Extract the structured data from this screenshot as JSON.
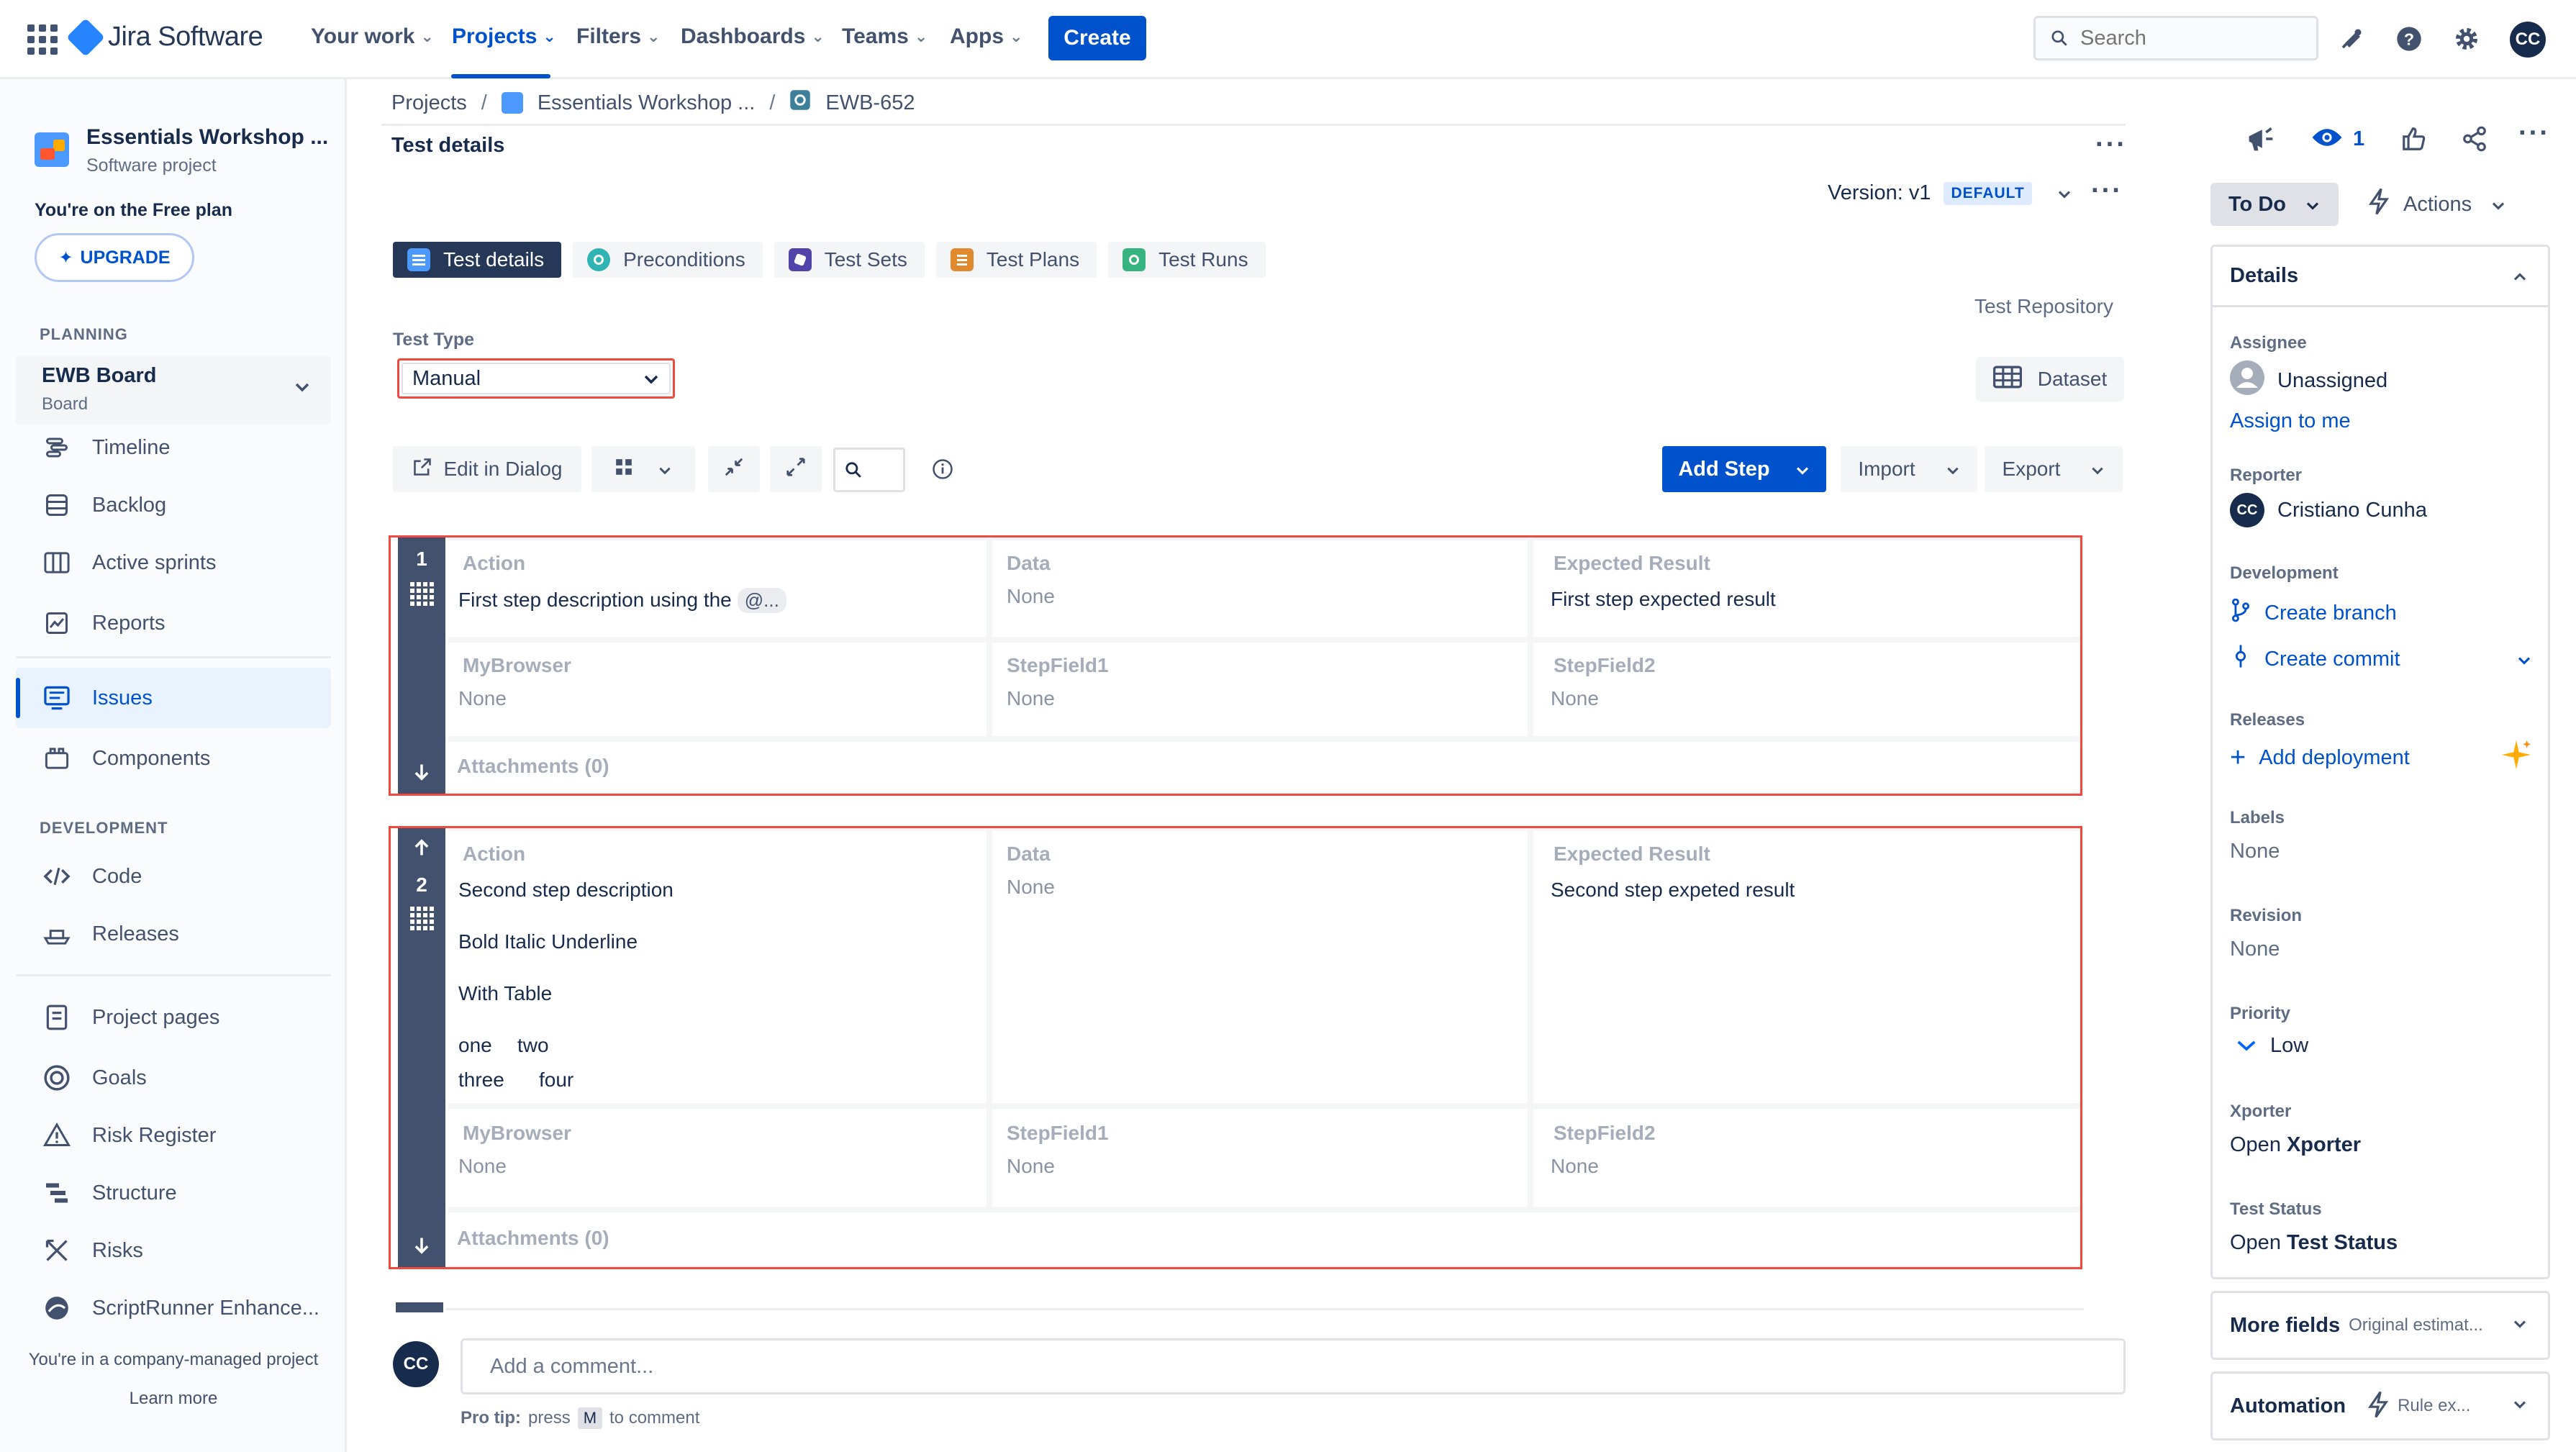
{
  "topnav": {
    "app_name": "Jira Software",
    "items": [
      {
        "label": "Your work"
      },
      {
        "label": "Projects"
      },
      {
        "label": "Filters"
      },
      {
        "label": "Dashboards"
      },
      {
        "label": "Teams"
      },
      {
        "label": "Apps"
      }
    ],
    "create_label": "Create",
    "search_placeholder": "Search",
    "avatar_initials": "CC"
  },
  "sidebar": {
    "project_name": "Essentials Workshop ...",
    "project_type": "Software project",
    "plan_note": "You're on the Free plan",
    "upgrade_label": "UPGRADE",
    "planning_heading": "PLANNING",
    "board_name": "EWB Board",
    "board_sub": "Board",
    "planning_items": [
      "Timeline",
      "Backlog",
      "Active sprints",
      "Reports"
    ],
    "issues_label": "Issues",
    "components_label": "Components",
    "development_heading": "DEVELOPMENT",
    "dev_items": [
      "Code",
      "Releases"
    ],
    "other_items": [
      "Project pages",
      "Goals",
      "Risk Register",
      "Structure",
      "Risks",
      "ScriptRunner Enhance..."
    ],
    "company_note": "You're in a company-managed project",
    "learn_more": "Learn more"
  },
  "breadcrumb": {
    "projects": "Projects",
    "project": "Essentials Workshop ...",
    "issue": "EWB-652",
    "sep": "/"
  },
  "main": {
    "section_title": "Test details",
    "version_label": "Version: v1",
    "version_badge": "DEFAULT",
    "tabs": [
      "Test details",
      "Preconditions",
      "Test Sets",
      "Test Plans",
      "Test Runs"
    ],
    "test_repository": "Test Repository",
    "test_type_label": "Test Type",
    "test_type_value": "Manual",
    "dataset_label": "Dataset",
    "edit_in_dialog": "Edit in Dialog",
    "add_step": "Add Step",
    "import": "Import",
    "export": "Export"
  },
  "steps": [
    {
      "number": "1",
      "action_label": "Action",
      "action_text": "First step description using the",
      "action_mention": "@...",
      "data_label": "Data",
      "data_value": "None",
      "expected_label": "Expected Result",
      "expected_value": "First step expected result",
      "f1_label": "MyBrowser",
      "f1_value": "None",
      "f2_label": "StepField1",
      "f2_value": "None",
      "f3_label": "StepField2",
      "f3_value": "None",
      "attachments": "Attachments (0)"
    },
    {
      "number": "2",
      "action_label": "Action",
      "action_lines": [
        "Second step description",
        "Bold Italic Underline",
        "With Table"
      ],
      "table": [
        [
          "one",
          "two"
        ],
        [
          "three",
          "four"
        ]
      ],
      "data_label": "Data",
      "data_value": "None",
      "expected_label": "Expected Result",
      "expected_value": "Second step expeted result",
      "f1_label": "MyBrowser",
      "f1_value": "None",
      "f2_label": "StepField1",
      "f2_value": "None",
      "f3_label": "StepField2",
      "f3_value": "None",
      "attachments": "Attachments (0)"
    }
  ],
  "comment": {
    "avatar": "CC",
    "placeholder": "Add a comment...",
    "pro_tip_bold": "Pro tip:",
    "pro_tip_pre": "press",
    "pro_tip_key": "M",
    "pro_tip_post": "to comment"
  },
  "right_panel": {
    "watch_count": "1",
    "status": "To Do",
    "actions": "Actions",
    "details_title": "Details",
    "assignee_label": "Assignee",
    "assignee_value": "Unassigned",
    "assign_to_me": "Assign to me",
    "reporter_label": "Reporter",
    "reporter_initials": "CC",
    "reporter_value": "Cristiano Cunha",
    "development_label": "Development",
    "create_branch": "Create branch",
    "create_commit": "Create commit",
    "releases_label": "Releases",
    "add_deployment": "Add deployment",
    "labels_label": "Labels",
    "labels_value": "None",
    "revision_label": "Revision",
    "revision_value": "None",
    "priority_label": "Priority",
    "priority_value": "Low",
    "xporter_label": "Xporter",
    "xporter_open": "Open",
    "xporter_name": "Xporter",
    "test_status_label": "Test Status",
    "test_status_open": "Open",
    "test_status_name": "Test Status",
    "more_fields": "More fields",
    "more_fields_sub": "Original estimat...",
    "automation": "Automation",
    "automation_sub": "Rule ex..."
  },
  "colors": {
    "brand": "#0052cc",
    "highlight_border": "#ef4a3d",
    "rail": "#42526e"
  }
}
